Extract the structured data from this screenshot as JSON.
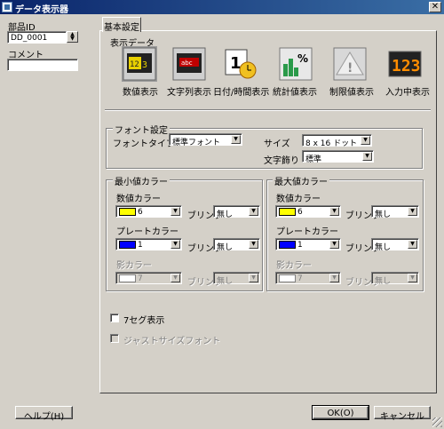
{
  "window": {
    "title": "データ表示器"
  },
  "left": {
    "part_id_label": "部品ID",
    "part_id_value": "DD_0001",
    "comment_label": "コメント",
    "comment_value": ""
  },
  "tab": {
    "label": "基本設定"
  },
  "display_data": {
    "label": "表示データ",
    "types": [
      {
        "label": "数値表示",
        "icon": "numeric-display-icon"
      },
      {
        "label": "文字列表示",
        "icon": "string-display-icon"
      },
      {
        "label": "日付/時間表示",
        "icon": "date-time-display-icon"
      },
      {
        "label": "統計値表示",
        "icon": "statistics-display-icon"
      },
      {
        "label": "制限値表示",
        "icon": "limit-display-icon"
      },
      {
        "label": "入力中表示",
        "icon": "input-display-icon"
      }
    ]
  },
  "font": {
    "group_label": "フォント設定",
    "type_label": "フォントタイプ",
    "type_value": "標準フォント",
    "size_label": "サイズ",
    "size_value": "8 x 16 ドット",
    "decoration_label": "文字飾り",
    "decoration_value": "標準"
  },
  "min_color": {
    "group_label": "最小値カラー",
    "numeric_label": "数値カラー",
    "numeric_value": "6",
    "numeric_color": "#ffff00",
    "blink_label": "ブリンク",
    "numeric_blink": "無し",
    "plate_label": "プレートカラー",
    "plate_value": "1",
    "plate_color": "#0000ff",
    "plate_blink": "無し",
    "shadow_label": "影カラー",
    "shadow_value": "7",
    "shadow_color": "#ffffff",
    "shadow_blink": "無し"
  },
  "max_color": {
    "group_label": "最大値カラー",
    "numeric_label": "数値カラー",
    "numeric_value": "6",
    "numeric_color": "#ffff00",
    "blink_label": "ブリンク",
    "numeric_blink": "無し",
    "plate_label": "プレートカラー",
    "plate_value": "1",
    "plate_color": "#0000ff",
    "plate_blink": "無し",
    "shadow_label": "影カラー",
    "shadow_value": "7",
    "shadow_color": "#ffffff",
    "shadow_blink": "無し"
  },
  "options": {
    "seven_seg_label": "7セグ表示",
    "seven_seg_checked": false,
    "just_size_label": "ジャストサイズフォント",
    "just_size_checked": false
  },
  "buttons": {
    "help": "ヘルプ(H)",
    "ok": "OK(O)",
    "cancel": "キャンセル"
  }
}
